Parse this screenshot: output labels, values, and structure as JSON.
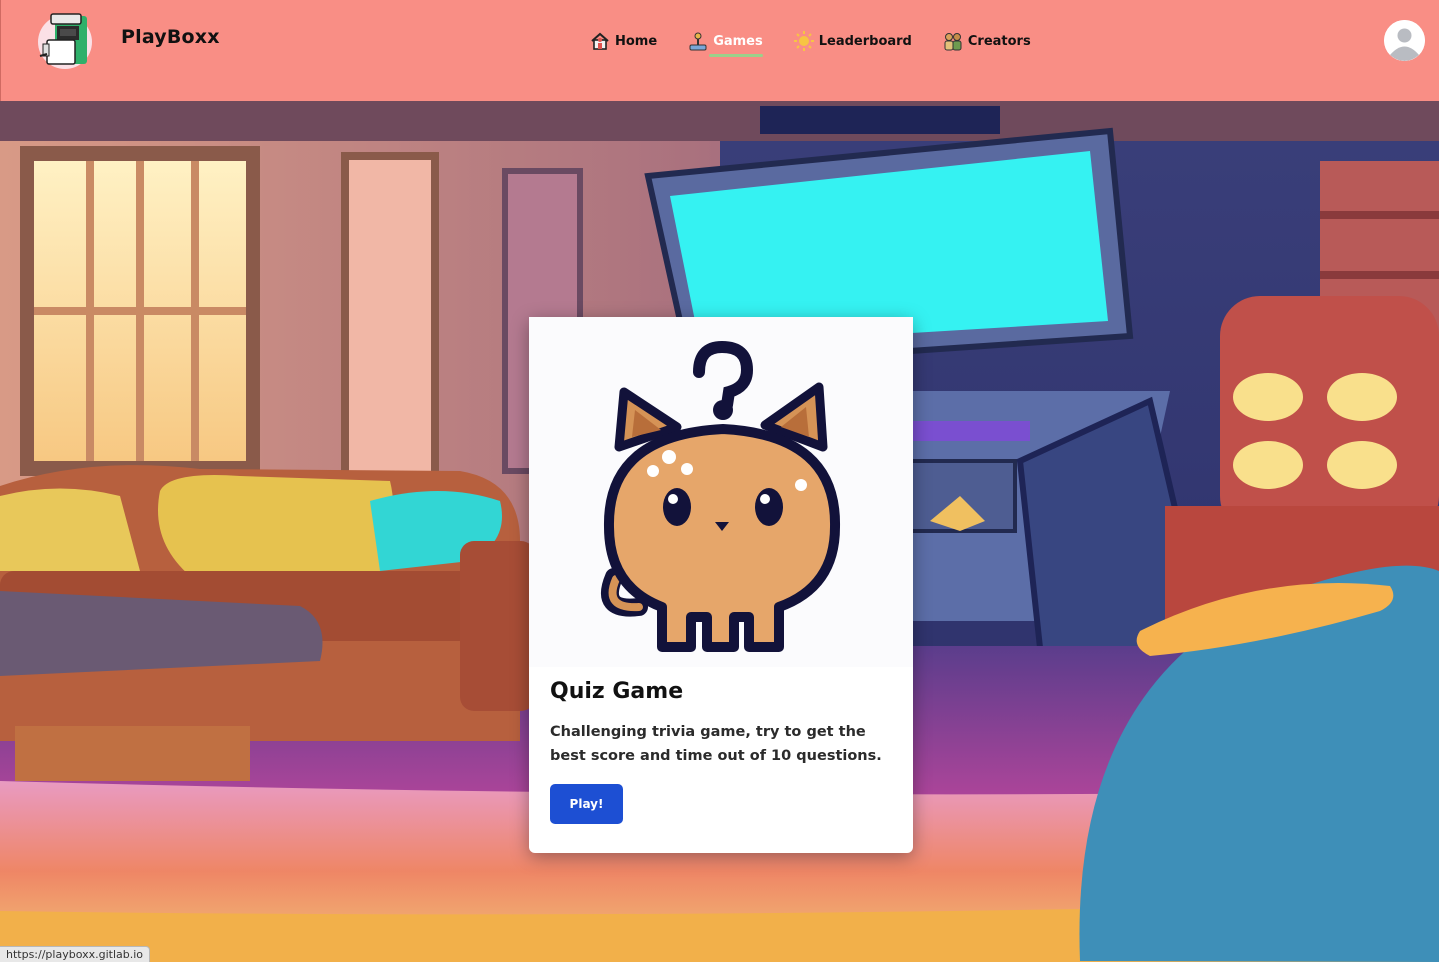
{
  "brand": {
    "name": "PlayBoxx"
  },
  "nav": {
    "items": [
      {
        "label": "Home",
        "icon": "house-icon",
        "active": false
      },
      {
        "label": "Games",
        "icon": "joystick-icon",
        "active": true
      },
      {
        "label": "Leaderboard",
        "icon": "sun-icon",
        "active": false
      },
      {
        "label": "Creators",
        "icon": "people-icon",
        "active": false
      }
    ]
  },
  "card": {
    "title": "Quiz Game",
    "description": "Challenging trivia game, try to get the best score and time out of 10 questions.",
    "button_label": "Play!"
  },
  "status_url": "https://playboxx.gitlab.io",
  "colors": {
    "header": "#f98e85",
    "accent": "#1d4fd3",
    "active_underline": "#9bd18a"
  }
}
